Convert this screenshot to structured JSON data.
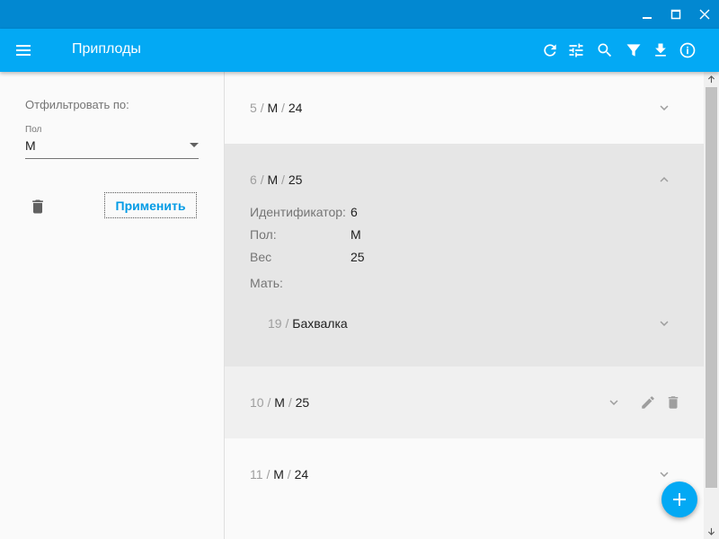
{
  "app": {
    "title": "Приплоды",
    "colors": {
      "appbar": "#03a9f4",
      "titlebar": "#0288d1",
      "accent": "#039be5"
    }
  },
  "toolbar": {
    "icons": [
      "refresh-icon",
      "tune-icon",
      "search-icon",
      "filter-icon",
      "download-icon",
      "info-icon"
    ]
  },
  "sidebar": {
    "filter_label": "Отфильтровать по:",
    "field_label": "Пол",
    "field_value": "М",
    "apply_label": "Применить"
  },
  "records": [
    {
      "id": "5",
      "sex": "М",
      "weight": "24",
      "sep": "/"
    },
    {
      "id": "6",
      "sex": "М",
      "weight": "25",
      "sep": "/",
      "expanded": true,
      "details": {
        "id_label": "Идентификатор:",
        "id_value": "6",
        "sex_label": "Пол:",
        "sex_value": "М",
        "weight_label": "Вес",
        "weight_value": "25",
        "mother_label": "Мать:",
        "mother": {
          "id": "19",
          "name": "Бахвалка",
          "sep": "/"
        }
      }
    },
    {
      "id": "10",
      "sex": "М",
      "weight": "25",
      "sep": "/",
      "hovered": true
    },
    {
      "id": "11",
      "sex": "М",
      "weight": "24",
      "sep": "/"
    }
  ]
}
